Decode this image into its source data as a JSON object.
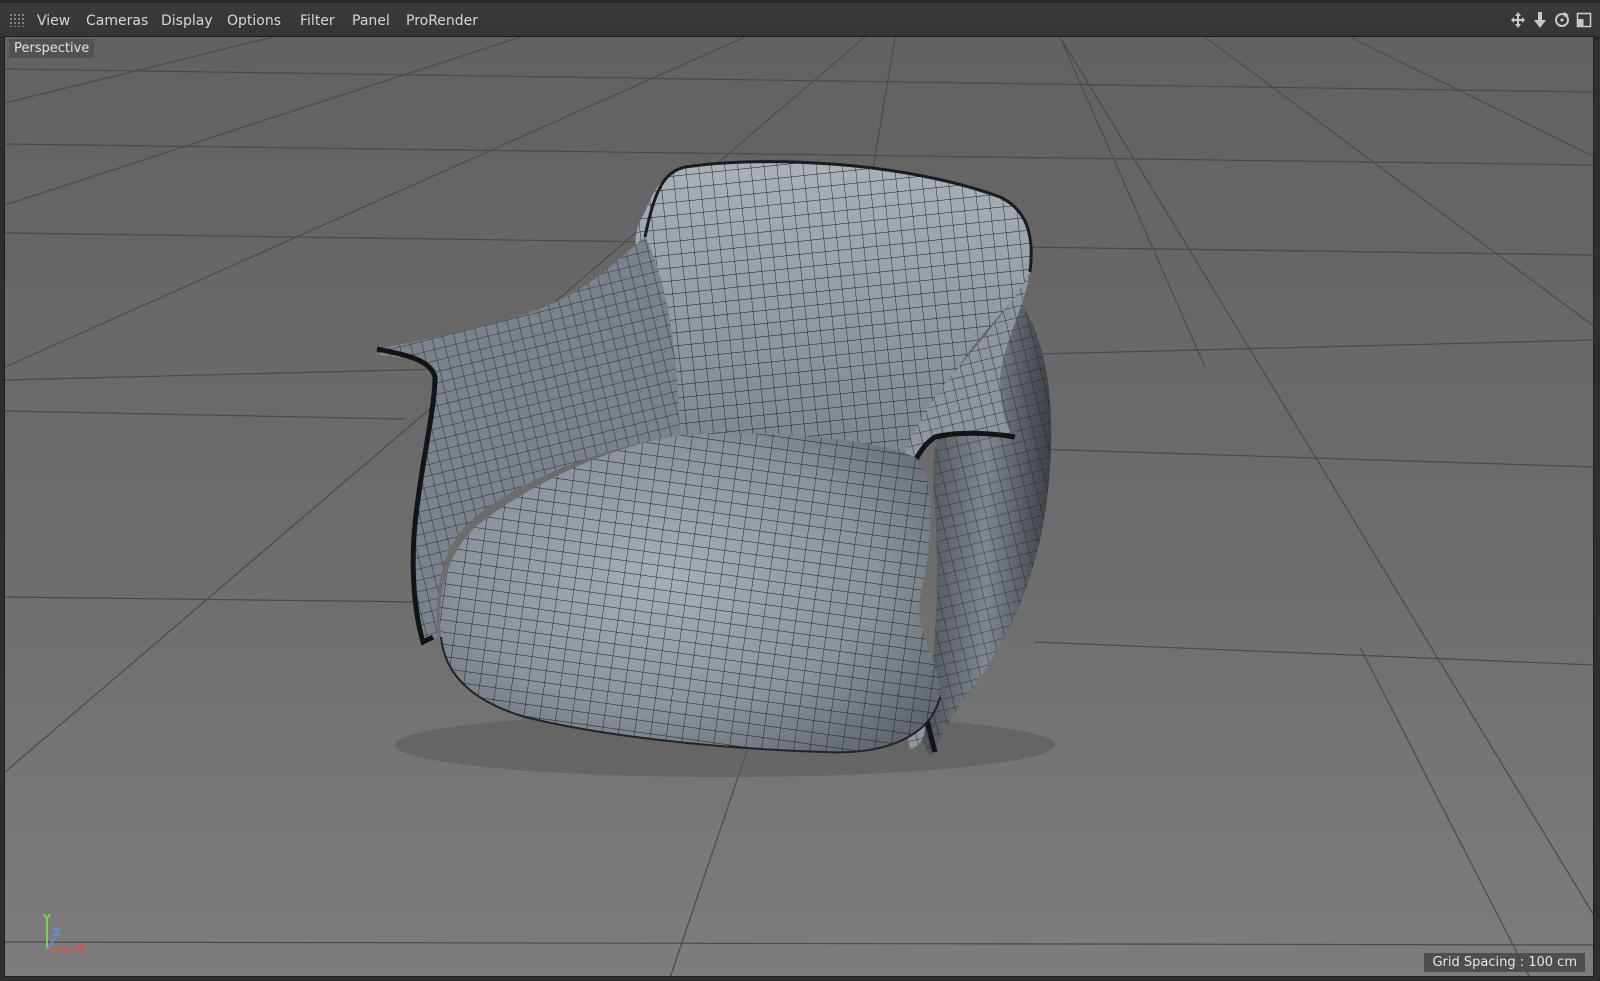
{
  "menubar": {
    "items": [
      {
        "label": "View"
      },
      {
        "label": "Cameras"
      },
      {
        "label": "Display"
      },
      {
        "label": "Options"
      },
      {
        "label": "Filter"
      },
      {
        "label": "Panel"
      },
      {
        "label": "ProRender"
      }
    ],
    "icons": [
      "move-view-icon",
      "zoom-view-icon",
      "rotate-view-icon",
      "toggle-layout-icon"
    ]
  },
  "viewport": {
    "camera_label": "Perspective",
    "grid_spacing": "Grid Spacing : 100 cm",
    "axis_labels": {
      "x": "X",
      "y": "Y",
      "z": "Z"
    }
  },
  "colors": {
    "background_top": "#656565",
    "background_bottom": "#7b7b7b",
    "grid_line": "#4a4a4a",
    "mesh_surface": "#8a939c",
    "wireframe": "#15181b",
    "axis_x": "#e0504a",
    "axis_y": "#7dd04a",
    "axis_z": "#6a8bd8"
  }
}
